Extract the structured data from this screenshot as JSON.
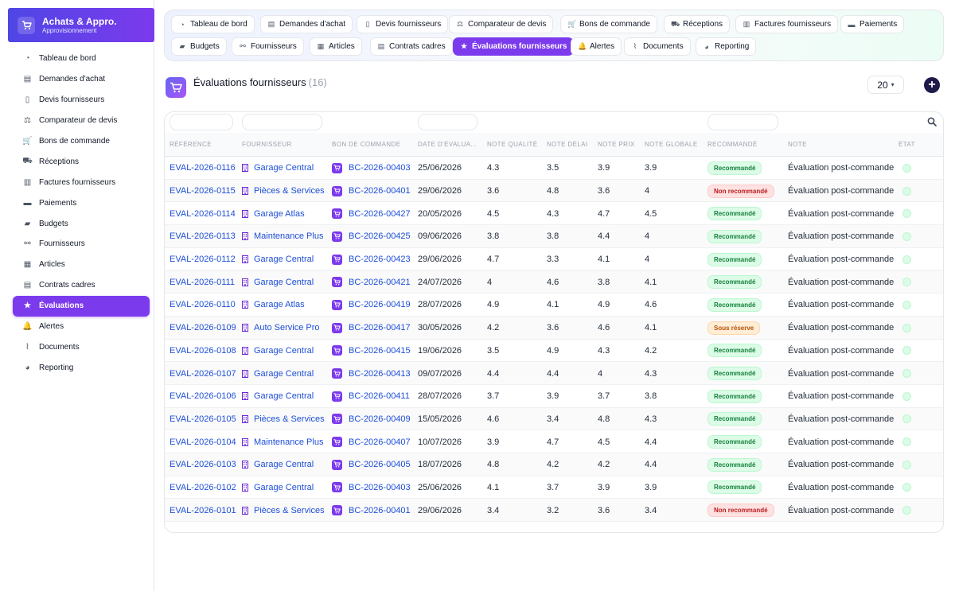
{
  "app": {
    "title": "Achats & Appro.",
    "subtitle": "Approvisionnement"
  },
  "sidebar": {
    "items": [
      {
        "label": "Tableau de bord",
        "icon": "dashboard-icon"
      },
      {
        "label": "Demandes d'achat",
        "icon": "clipboard-icon"
      },
      {
        "label": "Devis fournisseurs",
        "icon": "file-icon"
      },
      {
        "label": "Comparateur de devis",
        "icon": "scale-icon"
      },
      {
        "label": "Bons de commande",
        "icon": "cart-icon"
      },
      {
        "label": "Réceptions",
        "icon": "truck-icon"
      },
      {
        "label": "Factures fournisseurs",
        "icon": "invoice-icon"
      },
      {
        "label": "Paiements",
        "icon": "card-icon"
      },
      {
        "label": "Budgets",
        "icon": "wallet-icon"
      },
      {
        "label": "Fournisseurs",
        "icon": "handshake-icon"
      },
      {
        "label": "Articles",
        "icon": "box-icon"
      },
      {
        "label": "Contrats cadres",
        "icon": "contract-icon"
      },
      {
        "label": "Évaluations",
        "icon": "star-icon"
      },
      {
        "label": "Alertes",
        "icon": "bell-icon"
      },
      {
        "label": "Documents",
        "icon": "paperclip-icon"
      },
      {
        "label": "Reporting",
        "icon": "pie-chart-icon"
      }
    ],
    "active_index": 12
  },
  "tabs": {
    "row1": [
      {
        "label": "Tableau de bord",
        "icon": "dashboard-icon"
      },
      {
        "label": "Demandes d'achat",
        "icon": "clipboard-icon"
      },
      {
        "label": "Devis fournisseurs",
        "icon": "file-icon"
      },
      {
        "label": "Comparateur de devis",
        "icon": "scale-icon"
      },
      {
        "label": "Bons de commande",
        "icon": "cart-icon"
      },
      {
        "label": "Réceptions",
        "icon": "truck-icon"
      },
      {
        "label": "Factures fournisseurs",
        "icon": "invoice-icon"
      },
      {
        "label": "Paiements",
        "icon": "card-icon"
      }
    ],
    "row2": [
      {
        "label": "Budgets",
        "icon": "wallet-icon"
      },
      {
        "label": "Fournisseurs",
        "icon": "handshake-icon"
      },
      {
        "label": "Articles",
        "icon": "box-icon"
      },
      {
        "label": "Contrats cadres",
        "icon": "contract-icon"
      },
      {
        "label": "Évaluations fournisseurs",
        "icon": "star-icon",
        "active": true
      },
      {
        "label": "Alertes",
        "icon": "bell-icon"
      },
      {
        "label": "Documents",
        "icon": "paperclip-icon"
      },
      {
        "label": "Reporting",
        "icon": "pie-chart-icon"
      }
    ]
  },
  "header": {
    "title": "Évaluations fournisseurs",
    "count": "(16)",
    "page_size": "20",
    "add_icon": "plus-circle-icon"
  },
  "table": {
    "columns": [
      "Référence",
      "Fournisseur",
      "Bon de commande",
      "Date d'évalua...",
      "Note qualité",
      "Note délai",
      "Note prix",
      "Note globale",
      "Recommandé",
      "Note",
      "État"
    ],
    "rows": [
      {
        "ref": "EVAL-2026-0116",
        "supplier": "Garage Central",
        "po": "BC-2026-00403",
        "date": "25/06/2026",
        "quality": "4.3",
        "delay": "3.5",
        "price": "3.9",
        "global": "3.9",
        "rec": "Recommandé",
        "rec_type": "ok",
        "note": "Évaluation post-commande"
      },
      {
        "ref": "EVAL-2026-0115",
        "supplier": "Pièces & Services",
        "po": "BC-2026-00401",
        "date": "29/06/2026",
        "quality": "3.6",
        "delay": "4.8",
        "price": "3.6",
        "global": "4",
        "rec": "Non recommandé",
        "rec_type": "no",
        "note": "Évaluation post-commande"
      },
      {
        "ref": "EVAL-2026-0114",
        "supplier": "Garage Atlas",
        "po": "BC-2026-00427",
        "date": "20/05/2026",
        "quality": "4.5",
        "delay": "4.3",
        "price": "4.7",
        "global": "4.5",
        "rec": "Recommandé",
        "rec_type": "ok",
        "note": "Évaluation post-commande"
      },
      {
        "ref": "EVAL-2026-0113",
        "supplier": "Maintenance Plus",
        "po": "BC-2026-00425",
        "date": "09/06/2026",
        "quality": "3.8",
        "delay": "3.8",
        "price": "4.4",
        "global": "4",
        "rec": "Recommandé",
        "rec_type": "ok",
        "note": "Évaluation post-commande"
      },
      {
        "ref": "EVAL-2026-0112",
        "supplier": "Garage Central",
        "po": "BC-2026-00423",
        "date": "29/06/2026",
        "quality": "4.7",
        "delay": "3.3",
        "price": "4.1",
        "global": "4",
        "rec": "Recommandé",
        "rec_type": "ok",
        "note": "Évaluation post-commande"
      },
      {
        "ref": "EVAL-2026-0111",
        "supplier": "Garage Central",
        "po": "BC-2026-00421",
        "date": "24/07/2026",
        "quality": "4",
        "delay": "4.6",
        "price": "3.8",
        "global": "4.1",
        "rec": "Recommandé",
        "rec_type": "ok",
        "note": "Évaluation post-commande"
      },
      {
        "ref": "EVAL-2026-0110",
        "supplier": "Garage Atlas",
        "po": "BC-2026-00419",
        "date": "28/07/2026",
        "quality": "4.9",
        "delay": "4.1",
        "price": "4.9",
        "global": "4.6",
        "rec": "Recommandé",
        "rec_type": "ok",
        "note": "Évaluation post-commande"
      },
      {
        "ref": "EVAL-2026-0109",
        "supplier": "Auto Service Pro",
        "po": "BC-2026-00417",
        "date": "30/05/2026",
        "quality": "4.2",
        "delay": "3.6",
        "price": "4.6",
        "global": "4.1",
        "rec": "Sous réserve",
        "rec_type": "warn",
        "note": "Évaluation post-commande"
      },
      {
        "ref": "EVAL-2026-0108",
        "supplier": "Garage Central",
        "po": "BC-2026-00415",
        "date": "19/06/2026",
        "quality": "3.5",
        "delay": "4.9",
        "price": "4.3",
        "global": "4.2",
        "rec": "Recommandé",
        "rec_type": "ok",
        "note": "Évaluation post-commande"
      },
      {
        "ref": "EVAL-2026-0107",
        "supplier": "Garage Central",
        "po": "BC-2026-00413",
        "date": "09/07/2026",
        "quality": "4.4",
        "delay": "4.4",
        "price": "4",
        "global": "4.3",
        "rec": "Recommandé",
        "rec_type": "ok",
        "note": "Évaluation post-commande"
      },
      {
        "ref": "EVAL-2026-0106",
        "supplier": "Garage Central",
        "po": "BC-2026-00411",
        "date": "28/07/2026",
        "quality": "3.7",
        "delay": "3.9",
        "price": "3.7",
        "global": "3.8",
        "rec": "Recommandé",
        "rec_type": "ok",
        "note": "Évaluation post-commande"
      },
      {
        "ref": "EVAL-2026-0105",
        "supplier": "Pièces & Services",
        "po": "BC-2026-00409",
        "date": "15/05/2026",
        "quality": "4.6",
        "delay": "3.4",
        "price": "4.8",
        "global": "4.3",
        "rec": "Recommandé",
        "rec_type": "ok",
        "note": "Évaluation post-commande"
      },
      {
        "ref": "EVAL-2026-0104",
        "supplier": "Maintenance Plus",
        "po": "BC-2026-00407",
        "date": "10/07/2026",
        "quality": "3.9",
        "delay": "4.7",
        "price": "4.5",
        "global": "4.4",
        "rec": "Recommandé",
        "rec_type": "ok",
        "note": "Évaluation post-commande"
      },
      {
        "ref": "EVAL-2026-0103",
        "supplier": "Garage Central",
        "po": "BC-2026-00405",
        "date": "18/07/2026",
        "quality": "4.8",
        "delay": "4.2",
        "price": "4.2",
        "global": "4.4",
        "rec": "Recommandé",
        "rec_type": "ok",
        "note": "Évaluation post-commande"
      },
      {
        "ref": "EVAL-2026-0102",
        "supplier": "Garage Central",
        "po": "BC-2026-00403",
        "date": "25/06/2026",
        "quality": "4.1",
        "delay": "3.7",
        "price": "3.9",
        "global": "3.9",
        "rec": "Recommandé",
        "rec_type": "ok",
        "note": "Évaluation post-commande"
      },
      {
        "ref": "EVAL-2026-0101",
        "supplier": "Pièces & Services",
        "po": "BC-2026-00401",
        "date": "29/06/2026",
        "quality": "3.4",
        "delay": "3.2",
        "price": "3.6",
        "global": "3.4",
        "rec": "Non recommandé",
        "rec_type": "no",
        "note": "Évaluation post-commande"
      }
    ]
  },
  "colors": {
    "accent": "#7c3aed",
    "link": "#1d4ed8"
  }
}
